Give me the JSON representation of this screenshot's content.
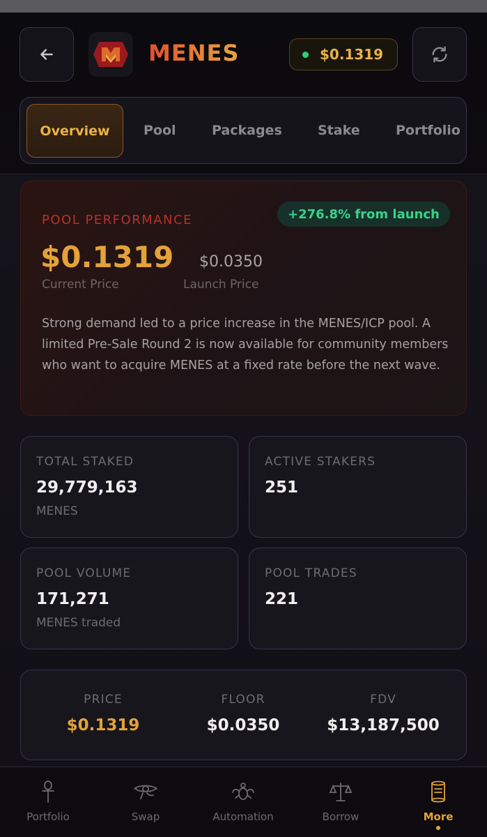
{
  "header": {
    "brand": "MENES",
    "price": "$0.1319"
  },
  "tabs": [
    {
      "label": "Overview",
      "active": true
    },
    {
      "label": "Pool"
    },
    {
      "label": "Packages"
    },
    {
      "label": "Stake"
    },
    {
      "label": "Portfolio"
    }
  ],
  "performance": {
    "title": "POOL PERFORMANCE",
    "badge": "+276.8% from launch",
    "current_price": "$0.1319",
    "current_label": "Current Price",
    "launch_price": "$0.0350",
    "launch_label": "Launch Price",
    "description": "Strong demand led to a price increase in the MENES/ICP pool. A limited Pre-Sale Round 2 is now available for community members who want to acquire MENES at a fixed rate before the next wave."
  },
  "stats": [
    {
      "label": "TOTAL STAKED",
      "value": "29,779,163",
      "unit": "MENES"
    },
    {
      "label": "ACTIVE STAKERS",
      "value": "251"
    },
    {
      "label": "POOL VOLUME",
      "value": "171,271",
      "unit": "MENES traded"
    },
    {
      "label": "POOL TRADES",
      "value": "221"
    }
  ],
  "summary": [
    {
      "label": "PRICE",
      "value": "$0.1319"
    },
    {
      "label": "FLOOR",
      "value": "$0.0350"
    },
    {
      "label": "FDV",
      "value": "$13,187,500"
    }
  ],
  "nav": [
    {
      "label": "Portfolio",
      "icon": "ankh-icon"
    },
    {
      "label": "Swap",
      "icon": "eye-icon"
    },
    {
      "label": "Automation",
      "icon": "scarab-icon"
    },
    {
      "label": "Borrow",
      "icon": "scales-icon"
    },
    {
      "label": "More",
      "icon": "scroll-icon",
      "active": true
    }
  ],
  "colors": {
    "accent_gold": "#e3a23a",
    "accent_red": "#b8312a",
    "positive_green": "#37d48a"
  }
}
